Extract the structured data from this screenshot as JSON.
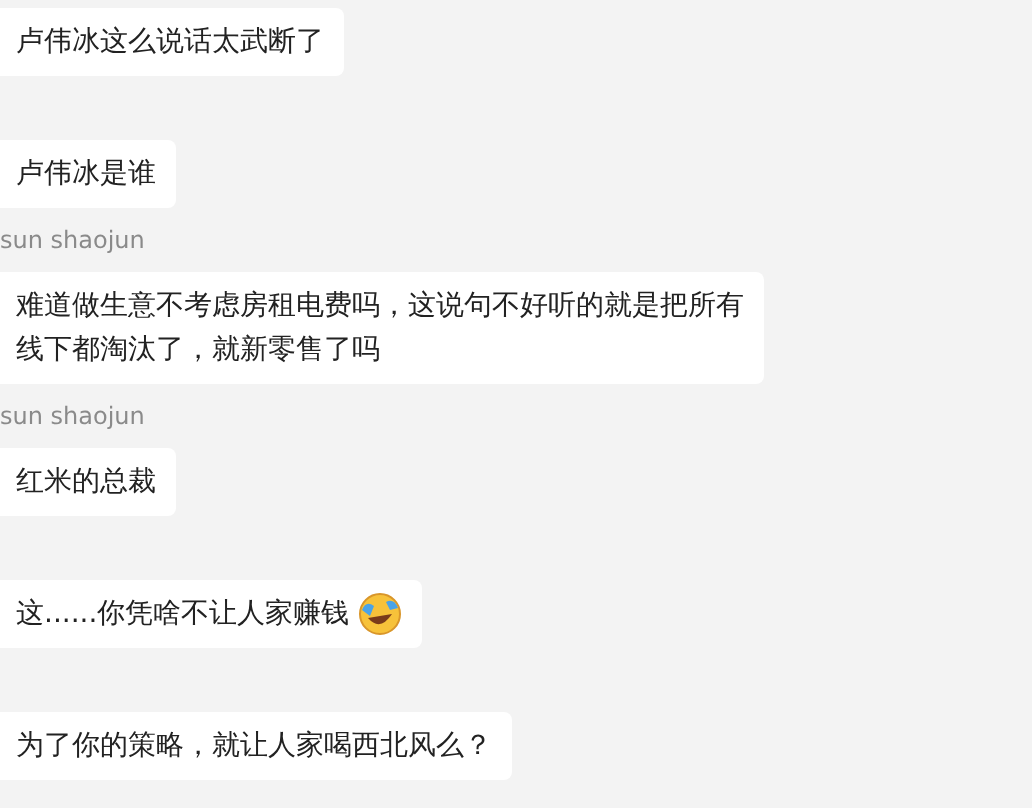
{
  "messages": [
    {
      "text": "卢伟冰这么说话太武断了",
      "emoji": false
    },
    {
      "text": "卢伟冰是谁",
      "emoji": false
    },
    {
      "sender": "sun shaojun",
      "text": "难道做生意不考虑房租电费吗，这说句不好听的就是把所有线下都淘汰了，就新零售了吗",
      "emoji": false
    },
    {
      "sender": "sun shaojun",
      "text": "红米的总裁",
      "emoji": false
    },
    {
      "text": "这......你凭啥不让人家赚钱",
      "emoji": true
    },
    {
      "text": "为了你的策略，就让人家喝西北风么？",
      "emoji": false
    }
  ]
}
